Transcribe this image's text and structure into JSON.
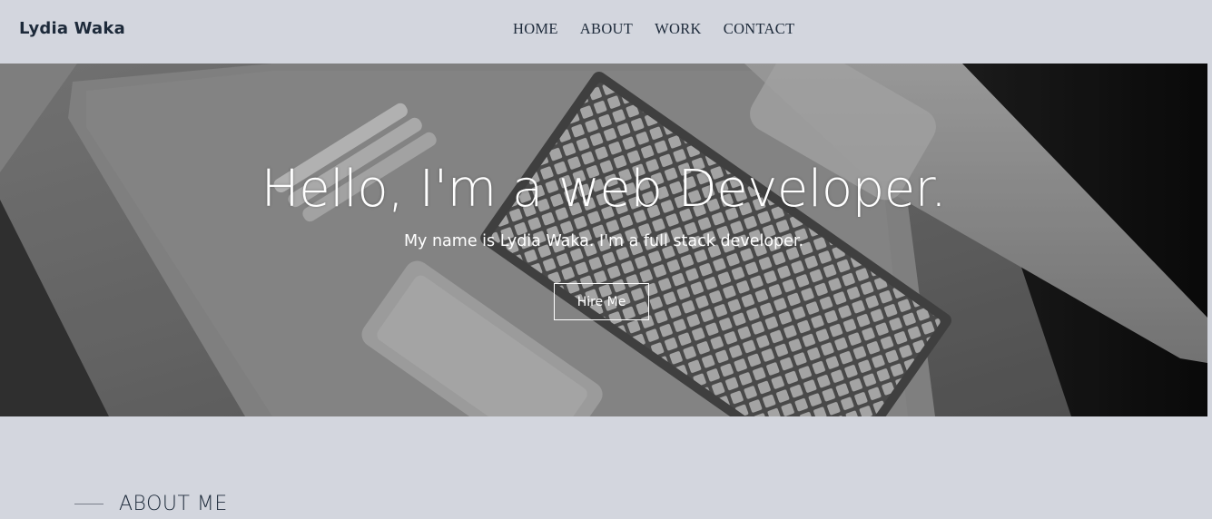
{
  "header": {
    "brand": "Lydia Waka",
    "nav": [
      "HOME",
      "ABOUT",
      "WORK",
      "CONTACT"
    ]
  },
  "hero": {
    "title": "Hello, I'm a web Developer.",
    "subtitle": "My name is Lydia Waka. I'm a full stack developer.",
    "cta_label": "Hire Me"
  },
  "about": {
    "heading": "ABOUT ME"
  },
  "colors": {
    "page_bg": "#d3d6de",
    "text_dark": "#1d2a3a",
    "hero_text": "#ffffff"
  }
}
